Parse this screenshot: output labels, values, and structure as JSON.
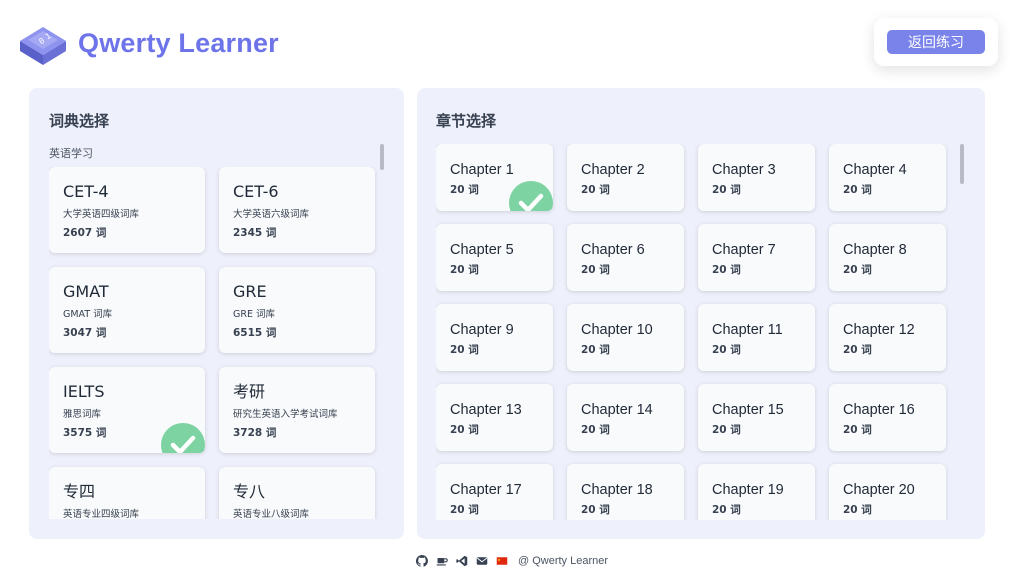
{
  "header": {
    "brand": "Qwerty Learner",
    "back_label": "返回练习",
    "logo_icon": "keyboard-key-icon",
    "brand_color": "#6d73e9"
  },
  "left_panel": {
    "title": "词典选择",
    "group_label": "英语学习",
    "dictionaries": [
      {
        "name": "CET-4",
        "desc": "大学英语四级词库",
        "count": "2607 词",
        "selected": false
      },
      {
        "name": "CET-6",
        "desc": "大学英语六级词库",
        "count": "2345 词",
        "selected": false
      },
      {
        "name": "GMAT",
        "desc": "GMAT 词库",
        "count": "3047 词",
        "selected": false
      },
      {
        "name": "GRE",
        "desc": "GRE 词库",
        "count": "6515 词",
        "selected": false
      },
      {
        "name": "IELTS",
        "desc": "雅思词库",
        "count": "3575 词",
        "selected": true
      },
      {
        "name": "考研",
        "desc": "研究生英语入学考试词库",
        "count": "3728 词",
        "selected": false
      },
      {
        "name": "专四",
        "desc": "英语专业四级词库",
        "count": "",
        "selected": false
      },
      {
        "name": "专八",
        "desc": "英语专业八级词库",
        "count": "",
        "selected": false
      }
    ]
  },
  "right_panel": {
    "title": "章节选择",
    "chapters": [
      {
        "name": "Chapter 1",
        "count": "20 词",
        "selected": true
      },
      {
        "name": "Chapter 2",
        "count": "20 词",
        "selected": false
      },
      {
        "name": "Chapter 3",
        "count": "20 词",
        "selected": false
      },
      {
        "name": "Chapter 4",
        "count": "20 词",
        "selected": false
      },
      {
        "name": "Chapter 5",
        "count": "20 词",
        "selected": false
      },
      {
        "name": "Chapter 6",
        "count": "20 词",
        "selected": false
      },
      {
        "name": "Chapter 7",
        "count": "20 词",
        "selected": false
      },
      {
        "name": "Chapter 8",
        "count": "20 词",
        "selected": false
      },
      {
        "name": "Chapter 9",
        "count": "20 词",
        "selected": false
      },
      {
        "name": "Chapter 10",
        "count": "20 词",
        "selected": false
      },
      {
        "name": "Chapter 11",
        "count": "20 词",
        "selected": false
      },
      {
        "name": "Chapter 12",
        "count": "20 词",
        "selected": false
      },
      {
        "name": "Chapter 13",
        "count": "20 词",
        "selected": false
      },
      {
        "name": "Chapter 14",
        "count": "20 词",
        "selected": false
      },
      {
        "name": "Chapter 15",
        "count": "20 词",
        "selected": false
      },
      {
        "name": "Chapter 16",
        "count": "20 词",
        "selected": false
      },
      {
        "name": "Chapter 17",
        "count": "20 词",
        "selected": false
      },
      {
        "name": "Chapter 18",
        "count": "20 词",
        "selected": false
      },
      {
        "name": "Chapter 19",
        "count": "20 词",
        "selected": false
      },
      {
        "name": "Chapter 20",
        "count": "20 词",
        "selected": false
      }
    ]
  },
  "footer": {
    "icons": [
      "github-icon",
      "coffee-icon",
      "vscode-icon",
      "mail-icon",
      "china-flag-icon"
    ],
    "text": "@ Qwerty Learner"
  },
  "colors": {
    "panel_bg": "#eef0fb",
    "accent": "#7a83ea",
    "check_green": "#6fcf97"
  }
}
